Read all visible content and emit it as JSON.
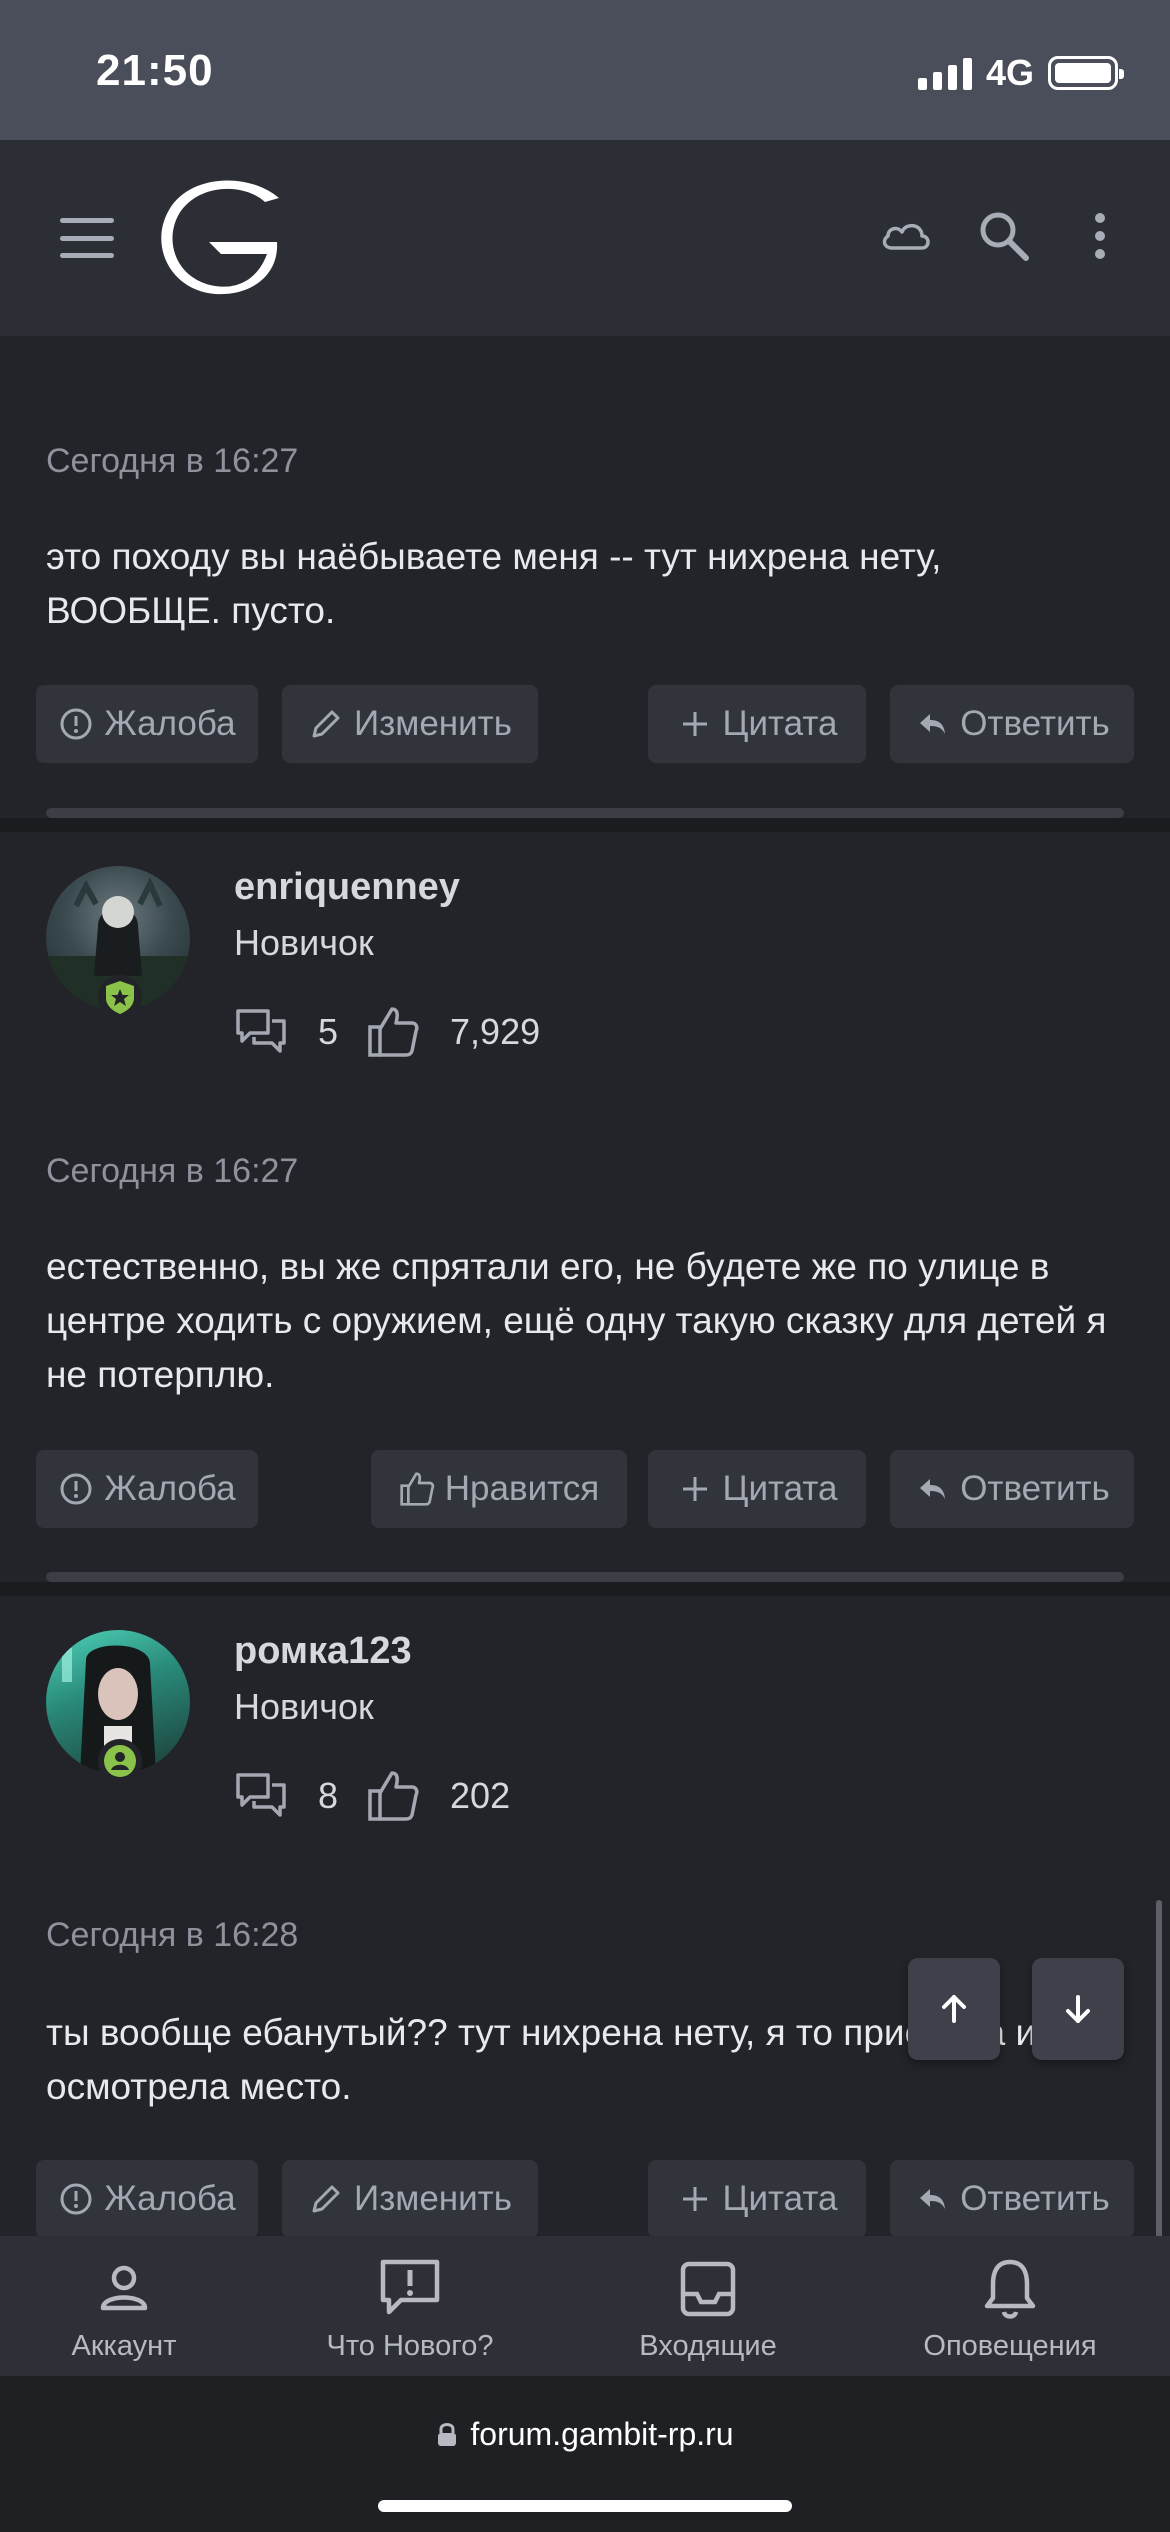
{
  "status_bar": {
    "time": "21:50",
    "network": "4G"
  },
  "header": {
    "logo_icon": "gambit-logo",
    "icons": [
      "menu-icon",
      "cloud-icon",
      "search-icon",
      "more-vertical-icon"
    ]
  },
  "posts": [
    {
      "time": "Сегодня в 16:27",
      "text": "это походу вы наёбываете меня -- тут нихрена нету, ВООБЩЕ. пусто.",
      "actions": [
        "Жалоба",
        "Изменить",
        "Цитата",
        "Ответить"
      ]
    },
    {
      "username": "enriquenney",
      "role": "Новичок",
      "messages": "5",
      "reactions": "7,929",
      "time": "Сегодня в 16:27",
      "text": "естественно, вы же спрятали его, не будете же по улице в центре ходить с оружием, ещё одну такую сказку для детей я не потерплю.",
      "actions": [
        "Жалоба",
        "Нравится",
        "Цитата",
        "Ответить"
      ]
    },
    {
      "username": "ромка123",
      "role": "Новичок",
      "messages": "8",
      "reactions": "202",
      "time": "Сегодня в 16:28",
      "text": "ты вообще ебанутый?? тут нихрена нету, я то приехала и осмотрела место.",
      "actions": [
        "Жалоба",
        "Изменить",
        "Цитата",
        "Ответить"
      ]
    }
  ],
  "bottom_nav": [
    {
      "label": "Аккаунт",
      "icon": "account-icon"
    },
    {
      "label": "Что Нового?",
      "icon": "whats-new-icon"
    },
    {
      "label": "Входящие",
      "icon": "inbox-icon"
    },
    {
      "label": "Оповещения",
      "icon": "bell-icon"
    }
  ],
  "browser": {
    "url": "forum.gambit-rp.ru"
  },
  "colors": {
    "background": "#232429",
    "header": "#2c2e35",
    "status_bar": "#4a4e5a",
    "badge_green": "#8bc34a"
  }
}
